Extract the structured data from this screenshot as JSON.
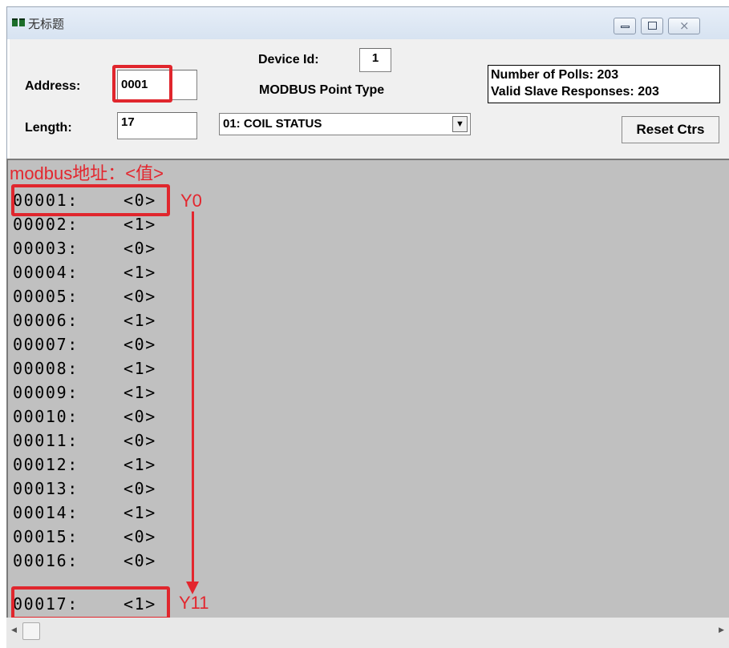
{
  "window": {
    "title": "无标题"
  },
  "form": {
    "address_label": "Address:",
    "address_value": "0001",
    "length_label": "Length:",
    "length_value": "17",
    "device_id_label": "Device Id:",
    "device_id_value": "1",
    "point_type_label": "MODBUS Point Type",
    "point_type_value": "01: COIL STATUS"
  },
  "stats": {
    "polls": "Number of Polls: 203",
    "responses": "Valid Slave Responses: 203",
    "reset_label": "Reset Ctrs"
  },
  "data": {
    "caption": "modbus地址：<值>",
    "rows": [
      {
        "addr": "00001:",
        "val": "<0>"
      },
      {
        "addr": "00002:",
        "val": "<1>"
      },
      {
        "addr": "00003:",
        "val": "<0>"
      },
      {
        "addr": "00004:",
        "val": "<1>"
      },
      {
        "addr": "00005:",
        "val": "<0>"
      },
      {
        "addr": "00006:",
        "val": "<1>"
      },
      {
        "addr": "00007:",
        "val": "<0>"
      },
      {
        "addr": "00008:",
        "val": "<1>"
      },
      {
        "addr": "00009:",
        "val": "<1>"
      },
      {
        "addr": "00010:",
        "val": "<0>"
      },
      {
        "addr": "00011:",
        "val": "<0>"
      },
      {
        "addr": "00012:",
        "val": "<1>"
      },
      {
        "addr": "00013:",
        "val": "<0>"
      },
      {
        "addr": "00014:",
        "val": "<1>"
      },
      {
        "addr": "00015:",
        "val": "<0>"
      },
      {
        "addr": "00016:",
        "val": "<0>"
      },
      {
        "addr": "00017:",
        "val": "<1>"
      }
    ],
    "annotation_first": "Y0",
    "annotation_last": "Y11"
  },
  "colors": {
    "annotation": "#e3262e",
    "data_bg": "#c0c0c0"
  }
}
